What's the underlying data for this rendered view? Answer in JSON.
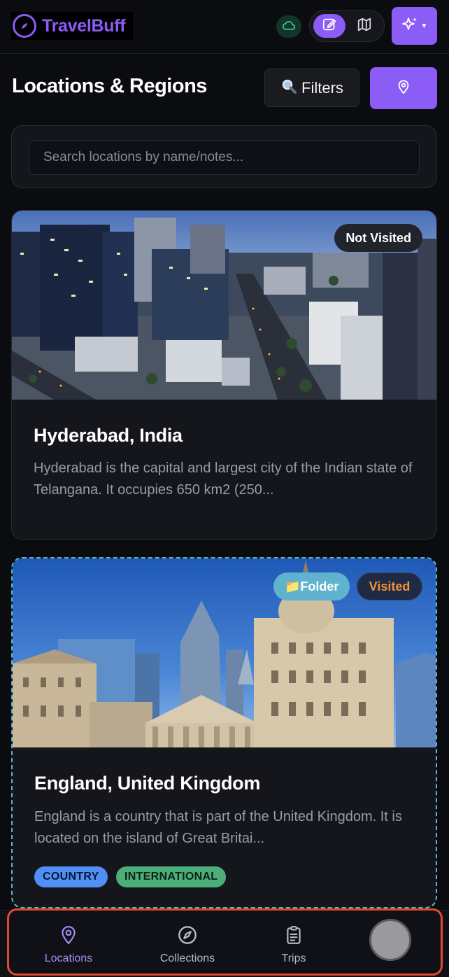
{
  "app": {
    "name": "TravelBuff"
  },
  "header": {
    "icons": [
      "cloud-sync-icon",
      "edit-icon",
      "map-icon",
      "sparkles-icon"
    ]
  },
  "page": {
    "title": "Locations & Regions",
    "filters_label": "Filters",
    "search_placeholder": "Search locations by name/notes..."
  },
  "locations": [
    {
      "title": "Hyderabad, India",
      "description": "Hyderabad is the capital and largest city of the Indian state of Telangana. It occupies 650 km2 (250...",
      "status": "Not Visited"
    },
    {
      "title": "England, United Kingdom",
      "description": "England is a country that is part of the United Kingdom. It is located on the island of Great Britai...",
      "folder_label": "📁Folder",
      "status": "Visited",
      "tags": [
        "COUNTRY",
        "INTERNATIONAL"
      ]
    }
  ],
  "nav": {
    "items": [
      "Locations",
      "Collections",
      "Trips"
    ],
    "active": "Locations"
  },
  "colors": {
    "accent": "#8b5cf6",
    "folder": "#5fb3cf",
    "visited": "#f0913a",
    "highlight": "#e04a2f"
  }
}
